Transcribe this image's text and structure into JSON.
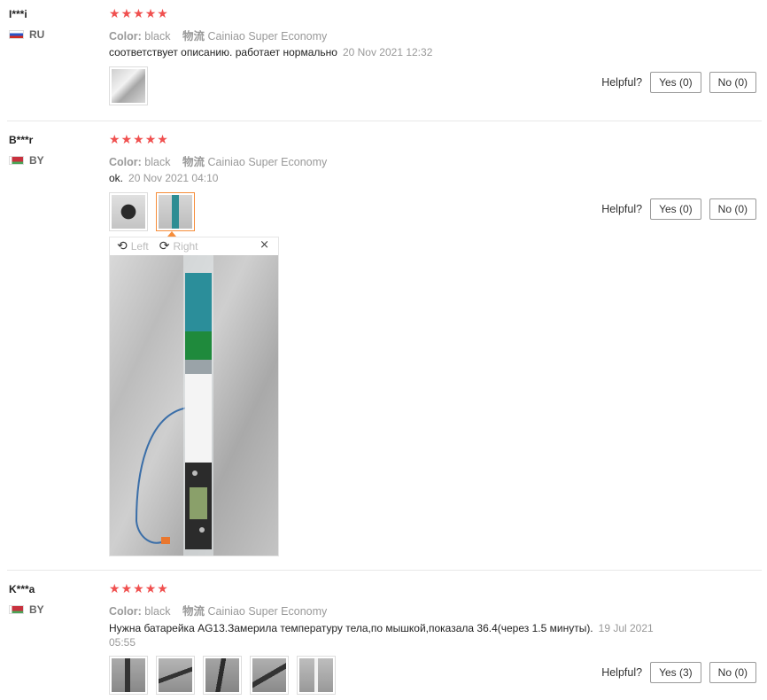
{
  "reviews": [
    {
      "user": "I***i",
      "country": "RU",
      "stars": 5,
      "color_label": "Color:",
      "color_value": "black",
      "ship_label": "物流",
      "ship_value": "Cainiao Super Economy",
      "text": "соответствует описанию. работает нормально",
      "date": "20 Nov 2021 12:32",
      "helpful_label": "Helpful?",
      "yes_label": "Yes (0)",
      "no_label": "No (0)"
    },
    {
      "user": "B***r",
      "country": "BY",
      "stars": 5,
      "color_label": "Color:",
      "color_value": "black",
      "ship_label": "物流",
      "ship_value": "Cainiao Super Economy",
      "text": "ok.",
      "date": "20 Nov 2021 04:10",
      "helpful_label": "Helpful?",
      "yes_label": "Yes (0)",
      "no_label": "No (0)"
    },
    {
      "user": "K***a",
      "country": "BY",
      "stars": 5,
      "color_label": "Color:",
      "color_value": "black",
      "ship_label": "物流",
      "ship_value": "Cainiao Super Economy",
      "text": "Нужна батарейка AG13.Замерила температуру тела,по мышкой,показала 36.4(через 1.5 минуты).",
      "date": "19 Jul 2021",
      "date2": "05:55",
      "helpful_label": "Helpful?",
      "yes_label": "Yes (3)",
      "no_label": "No (0)"
    }
  ],
  "viewer": {
    "rotate_left_label": "Left",
    "rotate_right_label": "Right",
    "close_symbol": "×"
  },
  "star_glyph": "★",
  "colors": {
    "star": "#f0504f",
    "active_thumb_border": "#f68d3a",
    "muted_text": "#999999"
  }
}
